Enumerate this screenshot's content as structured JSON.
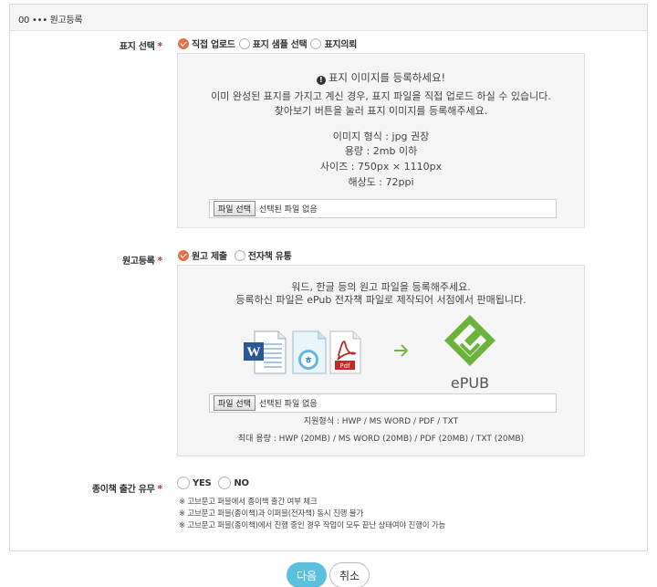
{
  "panel": {
    "title": "00 ••• 원고등록"
  },
  "cover": {
    "label": "표지 선택",
    "options": [
      "직접 업로드",
      "표지 샘플 선택",
      "표지의뢰"
    ],
    "selected": 0,
    "notice_title": "표지 이미지를 등록하세요!",
    "desc1": "이미 완성된 표지를 가지고 계신 경우, 표지 파일을 직접 업로드 하실 수 있습니다.",
    "desc2": "찾아보기 버튼을 눌러 표지 이미지를 등록해주세요.",
    "spec_format": "이미지 형식 : jpg 권장",
    "spec_size": "용량 : 2mb 이하",
    "spec_dimension": "사이즈 : 750px × 1110px",
    "spec_resolution": "해상도 : 72ppi",
    "file_button": "파일 선택",
    "file_status": "선택된 파일 없음"
  },
  "manuscript": {
    "label": "원고등록",
    "options": [
      "원고 제출",
      "전자책 유통"
    ],
    "selected": 0,
    "desc1": "워드, 한글 등의 원고 파일을 등록해주세요.",
    "desc2": "등록하신 파일은 ePub 전자책 파일로 제작되어 서점에서 판매됩니다.",
    "pdf_text": "Pdf",
    "epub_text": "ePUB",
    "file_button": "파일 선택",
    "file_status": "선택된 파일 없음",
    "supported": "지원형식 : HWP / MS WORD / PDF / TXT",
    "max_size": "최대 용량 : HWP (20MB) / MS WORD (20MB) / PDF (20MB) / TXT (20MB)"
  },
  "paper": {
    "label": "종이책 출간 유무",
    "options": [
      "YES",
      "NO"
    ],
    "notes": [
      "※ 고브문고 퍼블에서 종이책 출간 여부 체크",
      "※ 고브문고 퍼블(종이책)과 이퍼블(전자책) 동시 진행 불가",
      "※ 고브문고 퍼블(종이책)에서 진행 중인 경우 작업이 모두 끝난 상태여야 진행이 가능"
    ]
  },
  "buttons": {
    "next": "다음",
    "cancel": "취소"
  },
  "colors": {
    "accent": "#e8704a",
    "next_button": "#5bc0de",
    "required_star": "#c9302c",
    "epub_green": "#6cb33e"
  }
}
